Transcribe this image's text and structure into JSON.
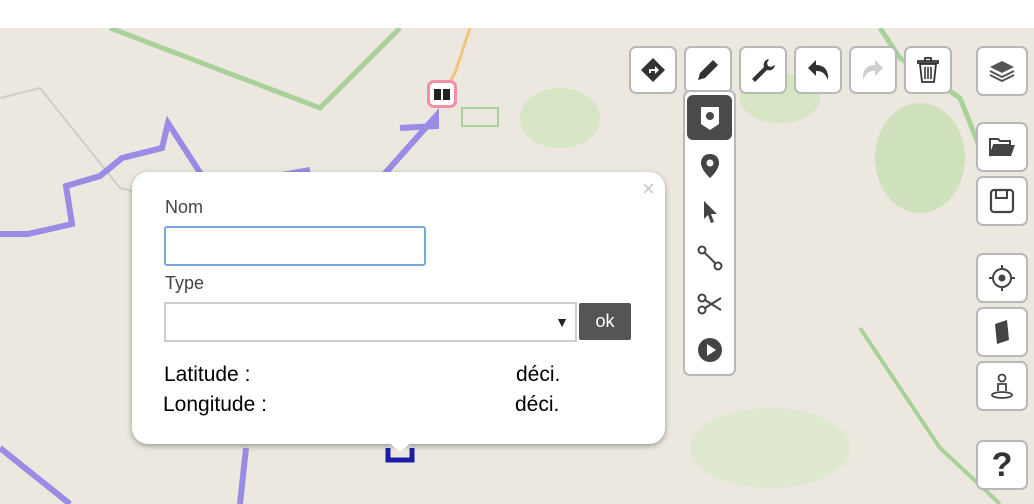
{
  "popup": {
    "close_symbol": "×",
    "name_label": "Nom",
    "name_value": "",
    "type_label": "Type",
    "type_selected": "",
    "type_arrow": "▼",
    "ok_label": "ok",
    "latitude_label": "Latitude :",
    "latitude_unit": "déci.",
    "longitude_label": "Longitude :",
    "longitude_unit": "déci."
  },
  "top_toolbar": [
    "directions-icon",
    "pencil-icon",
    "wrench-icon",
    "undo-icon",
    "redo-icon",
    "trash-icon"
  ],
  "draw_toolbar": [
    "marker-pin-icon",
    "location-pin-icon",
    "pointer-icon",
    "line-segment-icon",
    "scissors-icon",
    "play-icon"
  ],
  "right_toolbar": [
    "layers-icon",
    "open-folder-icon",
    "save-icon",
    "target-icon",
    "book-icon",
    "person-pin-icon",
    "help-icon"
  ],
  "help_label": "?",
  "colors": {
    "map_background": "#ece8df",
    "route_purple": "#8c7ae6",
    "park_green": "#cfe2bd",
    "marker_pink": "#ef8fa8",
    "active_tool": "#4a4a4a"
  }
}
